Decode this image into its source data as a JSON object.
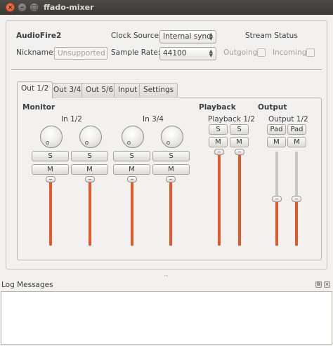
{
  "window": {
    "title": "ffado-mixer",
    "close_glyph": "×",
    "min_glyph": "–",
    "max_glyph": "□"
  },
  "device": {
    "name": "AudioFire2",
    "nickname_label": "Nickname:",
    "nickname_value": "Unsupported",
    "clock_source_label": "Clock Source:",
    "clock_source_value": "Internal sync",
    "sample_rate_label": "Sample Rate:",
    "sample_rate_value": "44100",
    "stream_status_label": "Stream Status",
    "outgoing_label": "Outgoing",
    "incoming_label": "Incoming"
  },
  "tabs": [
    {
      "label": "Out 1/2",
      "active": true
    },
    {
      "label": "Out 3/4",
      "active": false
    },
    {
      "label": "Out 5/6",
      "active": false
    },
    {
      "label": "Input",
      "active": false
    },
    {
      "label": "Settings",
      "active": false
    }
  ],
  "sections": {
    "monitor": "Monitor",
    "playback": "Playback",
    "output": "Output"
  },
  "groups": {
    "in12": "In 1/2",
    "in34": "In 3/4",
    "playback12": "Playback 1/2",
    "output12": "Output 1/2"
  },
  "buttons": {
    "solo": "S",
    "mute": "M",
    "pad": "Pad"
  },
  "faders": {
    "monitor_levels": [
      1.0,
      1.0,
      1.0,
      1.0
    ],
    "playback_levels": [
      1.0,
      1.0
    ],
    "output_levels": [
      0.5,
      0.5
    ]
  },
  "log": {
    "title": "Log Messages",
    "float_glyph": "⧉",
    "close_glyph": "×",
    "messages": ""
  },
  "colors": {
    "fader_active": "#e05a2a",
    "titlebar": "#3c3b37",
    "close_button": "#e0511d"
  }
}
